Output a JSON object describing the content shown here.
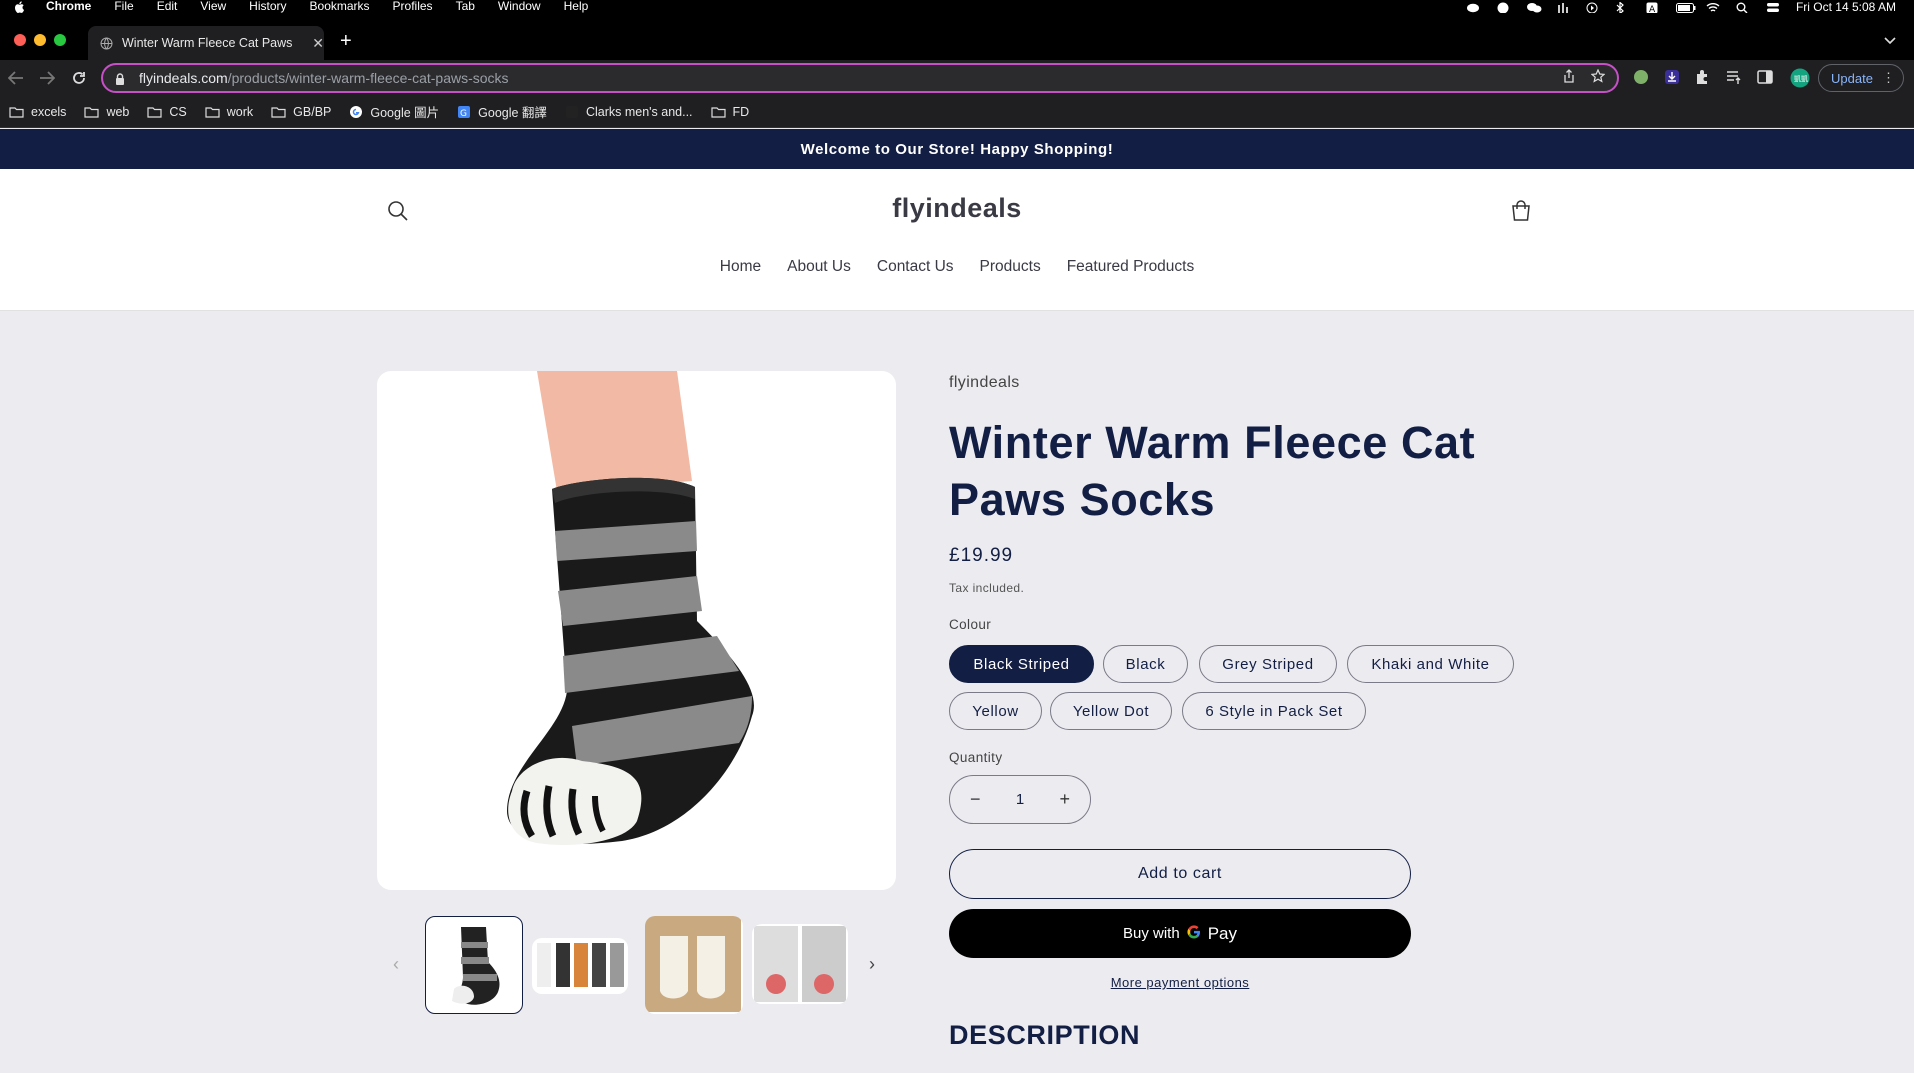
{
  "macos": {
    "menu": [
      "Chrome",
      "File",
      "Edit",
      "View",
      "History",
      "Bookmarks",
      "Profiles",
      "Tab",
      "Window",
      "Help"
    ],
    "clock": "Fri Oct 14  5:08 AM"
  },
  "browser": {
    "tab_title": "Winter Warm Fleece Cat Paws",
    "url_domain": "flyindeals.com",
    "url_path": "/products/winter-warm-fleece-cat-paws-socks",
    "update_label": "Update",
    "bookmarks": [
      "excels",
      "web",
      "CS",
      "work",
      "GB/BP",
      "Google 圖片",
      "Google 翻譯",
      "Clarks men's and...",
      "FD"
    ]
  },
  "store": {
    "announcement": "Welcome to Our Store! Happy Shopping!",
    "logo": "flyindeals",
    "nav": [
      "Home",
      "About Us",
      "Contact Us",
      "Products",
      "Featured Products"
    ]
  },
  "product": {
    "vendor": "flyindeals",
    "title": "Winter Warm Fleece Cat Paws Socks",
    "price": "£19.99",
    "tax_note": "Tax included.",
    "colour_label": "Colour",
    "colours": [
      "Black Striped",
      "Black",
      "Grey Striped",
      "Khaki and White",
      "Yellow",
      "Yellow Dot",
      "6 Style in Pack Set"
    ],
    "selected_colour": "Black Striped",
    "quantity_label": "Quantity",
    "quantity": "1",
    "add_to_cart": "Add to cart",
    "buy_with": "Buy with",
    "gpay": "Pay",
    "more_payment": "More payment options",
    "description_heading": "DESCRIPTION"
  },
  "colors": {
    "navy": "#121e44",
    "announcement_bg": "#121e44",
    "page_bg": "#ececf0",
    "omnibox_border": "#c750c9"
  }
}
